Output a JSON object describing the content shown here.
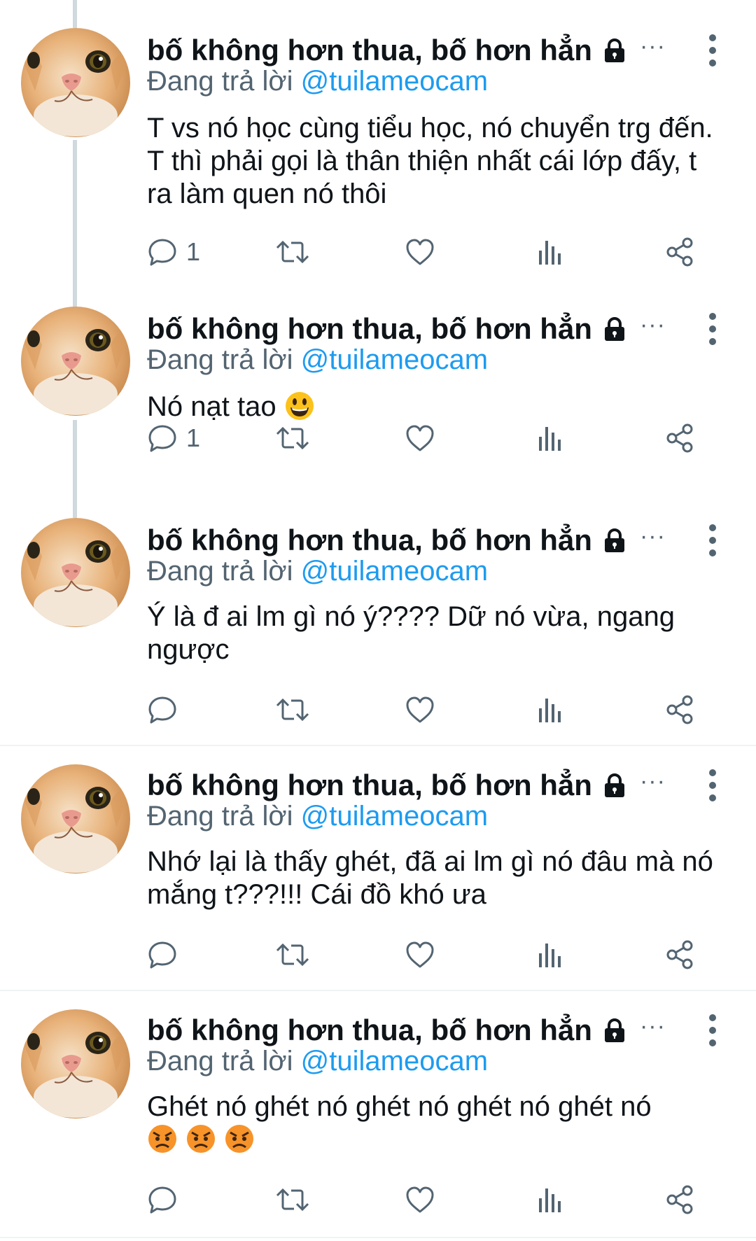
{
  "author": {
    "display_name": "bố không hơn thua, bố hơn hẳn",
    "protected_icon": "lock-icon",
    "more_icon": "more-vertical-icon"
  },
  "reply_prefix": "Đang trả lời",
  "reply_to": "@tuilameocam",
  "handle_overflow": "···",
  "accent_color": "#1d9bf0",
  "tweets": [
    {
      "text": "T vs nó học cùng tiểu học, nó chuyển trg đến. T thì phải gọi là thân thiện nhất cái lớp đấy, t ra làm quen nó thôi",
      "emoji": [],
      "reply_count": "1"
    },
    {
      "text": "Nó nạt tao",
      "emoji": [
        "grinning-face"
      ],
      "reply_count": "1"
    },
    {
      "text": "Ý là đ ai lm gì nó ý???? Dữ nó vừa, ngang ngược",
      "emoji": [],
      "reply_count": ""
    },
    {
      "text": "Nhớ lại là thấy ghét, đã ai lm gì nó đâu mà nó mắng t???!!! Cái đồ khó ưa",
      "emoji": [],
      "reply_count": ""
    },
    {
      "text": "Ghét nó ghét nó ghét nó ghét nó ghét nó",
      "emoji": [
        "angry-face",
        "angry-face",
        "angry-face"
      ],
      "reply_count": ""
    }
  ],
  "action_icons": [
    "reply-icon",
    "retweet-icon",
    "like-icon",
    "views-icon",
    "share-icon"
  ]
}
